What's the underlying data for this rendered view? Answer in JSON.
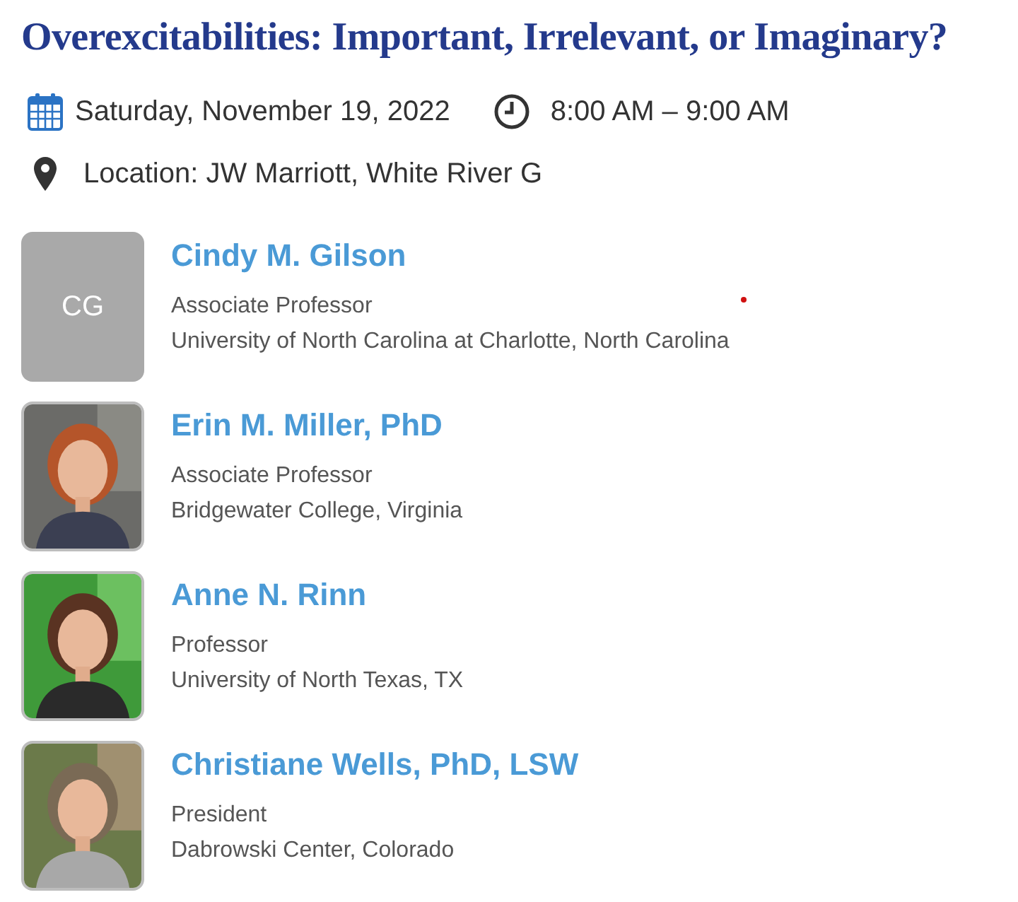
{
  "title": "Overexcitabilities: Important, Irrelevant, or Imaginary?",
  "date": "Saturday, November 19, 2022",
  "time": "8:00 AM – 9:00 AM",
  "location": "Location: JW Marriott, White River G",
  "speakers": [
    {
      "name": "Cindy M. Gilson",
      "role": "Associate Professor",
      "affiliation": "University of North Carolina at Charlotte, North Carolina",
      "avatar": {
        "kind": "initials",
        "text": "CG"
      }
    },
    {
      "name": "Erin M. Miller, PhD",
      "role": "Associate Professor",
      "affiliation": "Bridgewater College, Virginia"
    },
    {
      "name": "Anne N. Rinn",
      "role": "Professor",
      "affiliation": "University of North Texas, TX"
    },
    {
      "name": "Christiane Wells, PhD, LSW",
      "role": "President",
      "affiliation": "Dabrowski Center, Colorado"
    }
  ]
}
